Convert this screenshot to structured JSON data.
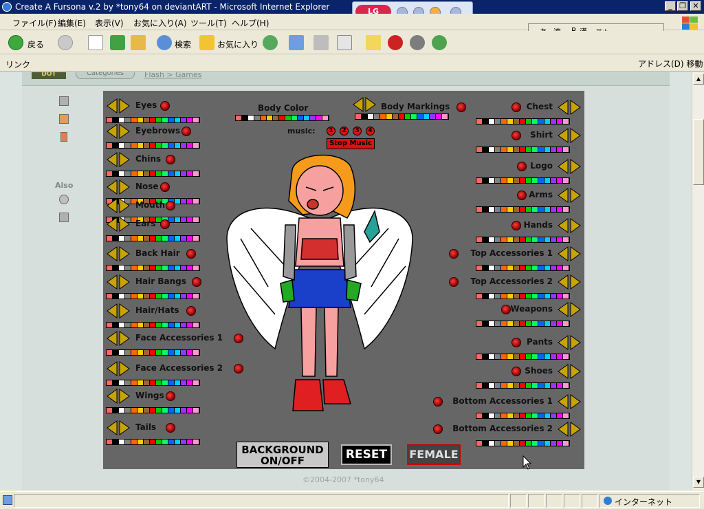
{
  "window": {
    "title": "Create A Fursona v.2 by *tony64 on deviantART - Microsoft Internet Explorer"
  },
  "lg_toolbar": {
    "label": "LG"
  },
  "menu": [
    {
      "id": "file",
      "label": "ファイル(F)"
    },
    {
      "id": "edit",
      "label": "編集(E)"
    },
    {
      "id": "view",
      "label": "表示(V)"
    },
    {
      "id": "favorites",
      "label": "お気に入り(A)"
    },
    {
      "id": "tools",
      "label": "ツール(T)"
    },
    {
      "id": "help",
      "label": "ヘルプ(H)"
    }
  ],
  "ime": {
    "mode": "あ",
    "ren": "連",
    "r": "R",
    "kan": "漢",
    "small": "英小"
  },
  "toolbar": {
    "back": "戻る",
    "search": "検索",
    "favorites": "お気に入り"
  },
  "links": {
    "label": "リンク",
    "address": "アドレス(D)",
    "go": "移動"
  },
  "page": {
    "dot_logo": "DOT",
    "categories": "Categories",
    "breadcrumb": "Flash > Games",
    "also": "Also",
    "footer": "©2004-2007 *tony64"
  },
  "flash": {
    "left_parts": [
      "Eyes",
      "Eyebrows",
      "Chins",
      "Nose",
      "Mouth",
      "Ears",
      "Back Hair",
      "Hair Bangs",
      "Hair/Hats",
      "Face Accessories 1",
      "Face Accessories 2",
      "Wings",
      "Tails"
    ],
    "right_parts": [
      "Chest",
      "Shirt",
      "Logo",
      "Arms",
      "Hands",
      "Top Accessories 1",
      "Top Accessories 2",
      "Weapons",
      "Pants",
      "Shoes",
      "Bottom Accessories 1",
      "Bottom Accessories 2"
    ],
    "body_color": "Body Color",
    "body_markings": "Body Markings",
    "music_label": "music:",
    "music_tracks": [
      "1",
      "2",
      "3",
      "4"
    ],
    "stop_music": "Stop Music",
    "background_toggle_line1": "BACKGROUND",
    "background_toggle_line2": "ON/OFF",
    "reset": "RESET",
    "gender": "FEMALE",
    "palette": [
      "#ff6666",
      "#000000",
      "#ffffff",
      "#808080",
      "#ff6600",
      "#ffcc00",
      "#996633",
      "#ff0000",
      "#00cc00",
      "#00ff66",
      "#0066ff",
      "#00ccff",
      "#9933ff",
      "#ff00ff",
      "#ff99cc"
    ]
  },
  "status": {
    "zone": "インターネット"
  },
  "colors": {
    "titlebar": "#0a246a",
    "flash_bg": "#666666",
    "arrow_gold": "#c8a400"
  }
}
